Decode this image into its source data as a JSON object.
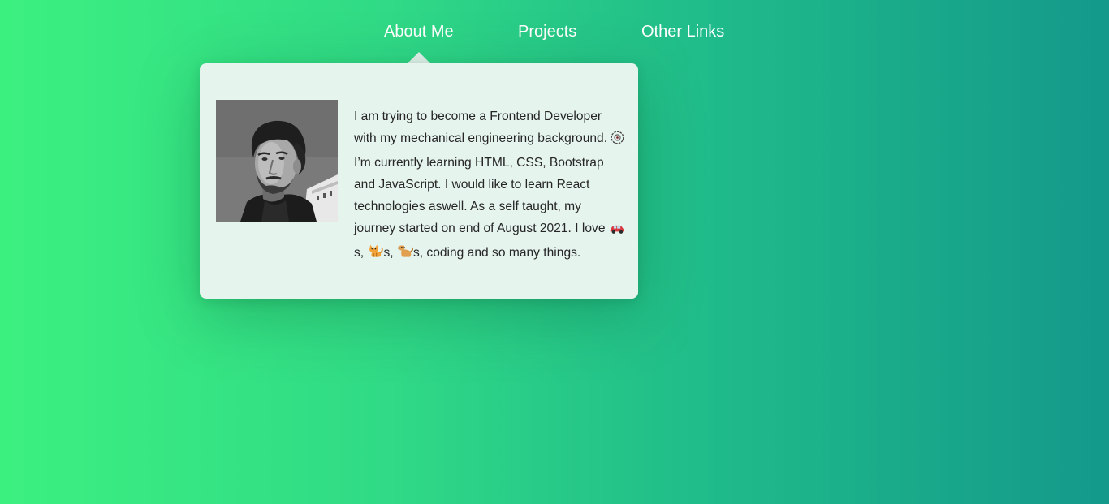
{
  "nav": {
    "items": [
      {
        "label": "About Me",
        "active": true
      },
      {
        "label": "Projects",
        "active": false
      },
      {
        "label": "Other Links",
        "active": false
      }
    ]
  },
  "about": {
    "bio_part1": "I am trying to become a Frontend Developer with my mechanical engineering background.",
    "bio_part2": " I’m currently learning HTML, CSS, Bootstrap and JavaScript. I would like to learn React technologies aswell. As a self taught, my journey started on end of August 2021. I love ",
    "bio_suffix_1": "s, ",
    "bio_suffix_2": "s, ",
    "bio_suffix_3": "s, coding and so many things.",
    "emoji_icons": [
      "gear-icon",
      "car-icon",
      "cat-icon",
      "dog-icon"
    ]
  },
  "colors": {
    "gradient_start": "#3cf080",
    "gradient_end": "#14998b",
    "card_background": "#e6f4ee",
    "nav_text": "#ffffff",
    "body_text": "#262626"
  }
}
